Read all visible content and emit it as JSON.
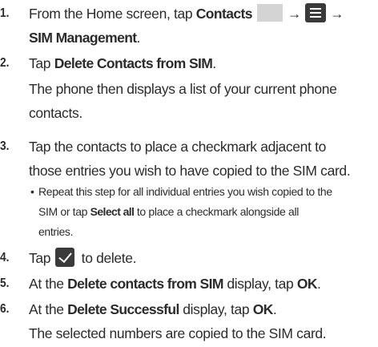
{
  "steps": [
    {
      "num": "1.",
      "t1": "From the Home screen, tap ",
      "b1": "Contacts",
      "arrow1": "→",
      "arrow2": "→",
      "b2": "SIM Management",
      "t2": "."
    },
    {
      "num": "2.",
      "t1": "Tap ",
      "b1": "Delete Contacts from SIM",
      "t2": ".",
      "line2": "The phone then displays a list of your current phone",
      "line3": "contacts."
    },
    {
      "num": "3.",
      "line1": "Tap the contacts to place a checkmark adjacent to",
      "line2": "those entries you wish to have copied to the SIM card.",
      "bullet": "•",
      "sub1": "Repeat this step for all individual entries you wish copied to the",
      "sub2a": "SIM or tap ",
      "sub2b": "Select all",
      "sub2c": " to place a checkmark alongside all",
      "sub3": "entries."
    },
    {
      "num": "4.",
      "t1": "Tap",
      "t2": " to delete."
    },
    {
      "num": "5.",
      "t1": "At the ",
      "b1": "Delete contacts from SIM",
      "t2": " display, tap ",
      "b2": "OK",
      "t3": "."
    },
    {
      "num": "6.",
      "t1": "At the ",
      "b1": "Delete Successful",
      "t2": " display, tap ",
      "b2": "OK",
      "t3": ".",
      "line2": "The selected numbers are copied to the SIM card."
    }
  ],
  "icons": [
    "contacts-app-icon",
    "menu-icon",
    "checkmark-icon"
  ]
}
